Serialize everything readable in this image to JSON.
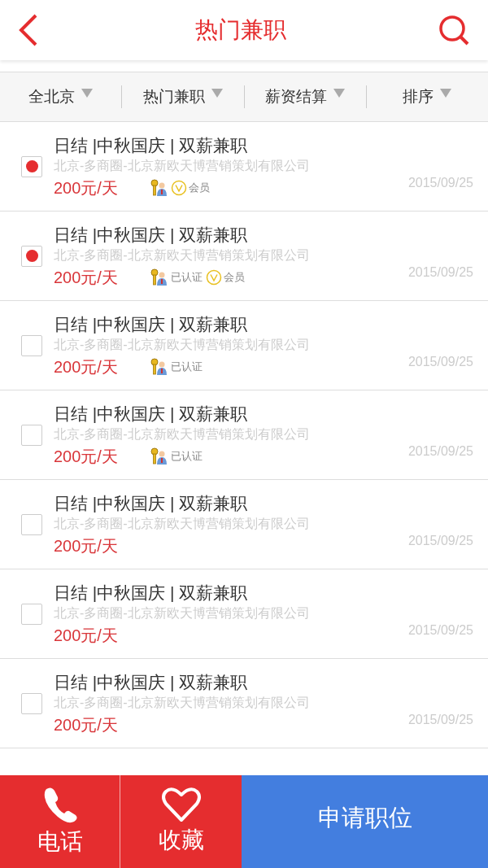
{
  "header": {
    "title": "热门兼职"
  },
  "filters": [
    {
      "label": "全北京"
    },
    {
      "label": "热门兼职"
    },
    {
      "label": "薪资结算"
    },
    {
      "label": "排序"
    }
  ],
  "jobs": [
    {
      "title": "日结 |中秋国庆 | 双薪兼职",
      "company": "北京-多商圈-北京新欧天博营销策划有限公司",
      "pay": "200元/天",
      "date": "2015/09/25",
      "checked": true,
      "badges": [
        {
          "kind": "verified"
        },
        {
          "kind": "member",
          "label": "会员"
        }
      ]
    },
    {
      "title": "日结 |中秋国庆 | 双薪兼职",
      "company": "北京-多商圈-北京新欧天博营销策划有限公司",
      "pay": "200元/天",
      "date": "2015/09/25",
      "checked": true,
      "badges": [
        {
          "kind": "verified",
          "label": "已认证"
        },
        {
          "kind": "member",
          "label": "会员"
        }
      ]
    },
    {
      "title": "日结 |中秋国庆 | 双薪兼职",
      "company": "北京-多商圈-北京新欧天博营销策划有限公司",
      "pay": "200元/天",
      "date": "2015/09/25",
      "checked": false,
      "badges": [
        {
          "kind": "verified",
          "label": "已认证"
        }
      ]
    },
    {
      "title": "日结 |中秋国庆 | 双薪兼职",
      "company": "北京-多商圈-北京新欧天博营销策划有限公司",
      "pay": "200元/天",
      "date": "2015/09/25",
      "checked": false,
      "badges": [
        {
          "kind": "verified",
          "label": "已认证"
        }
      ]
    },
    {
      "title": "日结 |中秋国庆 | 双薪兼职",
      "company": "北京-多商圈-北京新欧天博营销策划有限公司",
      "pay": "200元/天",
      "date": "2015/09/25",
      "checked": false
    },
    {
      "title": "日结 |中秋国庆 | 双薪兼职",
      "company": "北京-多商圈-北京新欧天博营销策划有限公司",
      "pay": "200元/天",
      "date": "2015/09/25",
      "checked": false
    },
    {
      "title": "日结 |中秋国庆 | 双薪兼职",
      "company": "北京-多商圈-北京新欧天博营销策划有限公司",
      "pay": "200元/天",
      "date": "2015/09/25",
      "checked": false
    }
  ],
  "bottom_bar": {
    "call": "电话",
    "favorite": "收藏",
    "apply": "申请职位"
  }
}
